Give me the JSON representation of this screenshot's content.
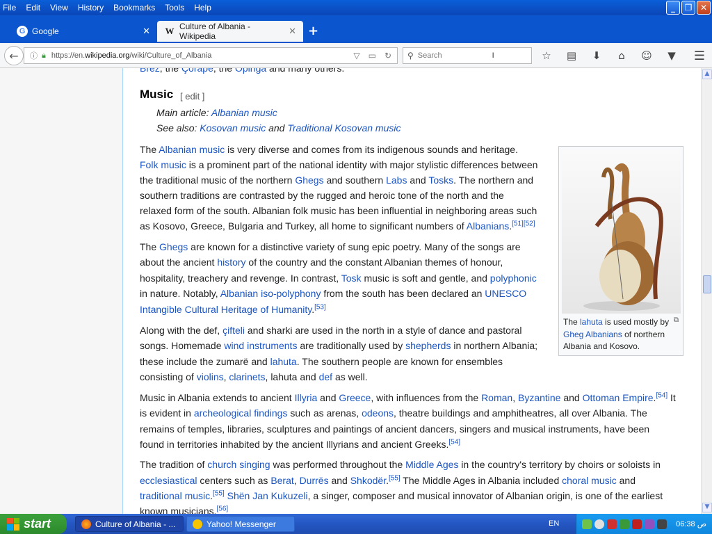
{
  "menu": [
    "File",
    "Edit",
    "View",
    "History",
    "Bookmarks",
    "Tools",
    "Help"
  ],
  "tabs": [
    {
      "label": "Google",
      "icon": "G"
    },
    {
      "label": "Culture of Albania - Wikipedia",
      "icon": "W"
    }
  ],
  "url": {
    "prefix": "https://en.",
    "domain": "wikipedia.org",
    "path": "/wiki/Culture_of_Albania"
  },
  "search": {
    "placeholder": "Search"
  },
  "article": {
    "top_line": {
      "a": "Brez",
      "sep1": ", the ",
      "b": "Çorape",
      "sep2": ", the ",
      "c": "Opinga",
      "tail": " and many others."
    },
    "heading": "Music",
    "edit": "[ edit ]",
    "main_article": {
      "label": "Main article: ",
      "link": "Albanian music"
    },
    "see_also": {
      "label": "See also: ",
      "link1": "Kosovan music",
      "and": " and ",
      "link2": "Traditional Kosovan music"
    },
    "p1": {
      "l1": {
        "a": "The ",
        "b": "Albanian music",
        "c": " is very diverse and comes from its indigenous sounds and heritage."
      },
      "l2": {
        "a": "Folk music",
        "b": " is a prominent part of the national identity with major stylistic differences between"
      },
      "l3": {
        "a": "the traditional music of the northern ",
        "b": "Ghegs",
        "c": " and southern ",
        "d": "Labs",
        "e": " and ",
        "f": "Tosks",
        "g": ". The northern and"
      },
      "l4": "southern traditions are contrasted by the rugged and heroic tone of the north and the",
      "l5": "relaxed form of the south. Albanian folk music has been influential in neighboring areas such",
      "l6": {
        "a": "as Kosovo, Greece, Bulgaria and Turkey, all home to significant numbers of ",
        "b": "Albanians",
        "c": ".",
        "sup": "[51][52]"
      }
    },
    "p2": {
      "l1": {
        "a": "The ",
        "b": "Ghegs",
        "c": " are known for a distinctive variety of sung epic poetry. Many of the songs are"
      },
      "l2": {
        "a": "about the ancient ",
        "b": "history",
        "c": " of the country and the constant Albanian themes of honour,"
      },
      "l3": {
        "a": "hospitality, treachery and revenge. In contrast, ",
        "b": "Tosk",
        "c": " music is soft and gentle, and ",
        "d": "polyphonic"
      },
      "l4": {
        "a": "in nature. Notably, ",
        "b": "Albanian iso-polyphony",
        "c": " from the south has been declared an ",
        "d": "UNESCO"
      },
      "l5": {
        "a": "Intangible Cultural Heritage of Humanity",
        "b": ".",
        "sup": "[53]"
      }
    },
    "p3": {
      "l1": {
        "a": "Along with the def, ",
        "b": "çifteli",
        "c": " and sharki are used in the north in a style of dance and pastoral"
      },
      "l2": {
        "a": "songs. Homemade ",
        "b": "wind instruments",
        "c": " are traditionally used by ",
        "d": "shepherds",
        "e": " in northern Albania;"
      },
      "l3": {
        "a": "these include the zumarë and ",
        "b": "lahuta",
        "c": ". The southern people are known for ensembles"
      },
      "l4": {
        "a": "consisting of ",
        "b": "violins",
        "c": ", ",
        "d": "clarinets",
        "e": ", lahuta and ",
        "f": "def",
        "g": " as well."
      }
    },
    "p4": {
      "l1": {
        "a": "Music in Albania extends to ancient ",
        "b": "Illyria",
        "c": " and ",
        "d": "Greece",
        "e": ", with influences from the ",
        "f": "Roman",
        "g": ", ",
        "h": "Byzantine",
        "i": " and ",
        "j": "Ottoman Empire",
        "k": ".",
        "sup": "[54]",
        "l": " It"
      },
      "l2": {
        "a": "is evident in ",
        "b": "archeological findings",
        "c": " such as arenas, ",
        "d": "odeons",
        "e": ", theatre buildings and amphitheatres, all over Albania. The"
      },
      "l3": "remains of temples, libraries, sculptures and paintings of ancient dancers, singers and musical instruments, have been",
      "l4": {
        "a": "found in territories inhabited by the ancient Illyrians and ancient Greeks.",
        "sup": "[54]"
      }
    },
    "p5": {
      "l1": {
        "a": "The tradition of ",
        "b": "church singing",
        "c": " was performed throughout the ",
        "d": "Middle Ages",
        "e": " in the country's territory by choirs or soloists in"
      },
      "l2": {
        "a": "ecclesiastical",
        "b": " centers such as ",
        "c": "Berat",
        "d": ", ",
        "e": "Durrës",
        "f": " and ",
        "g": "Shkodër",
        "h": ".",
        "sup": "[55]",
        "i": " The Middle Ages in Albania included ",
        "j": "choral music",
        "k": " and"
      },
      "l3": {
        "a": "traditional music",
        "b": ".",
        "sup": "[55]",
        "c": " ",
        "d": "Shën Jan Kukuzeli",
        "e": ", a singer, composer and musical innovator of Albanian origin, is one of the earliest"
      },
      "l4": {
        "a": "known musicians.",
        "sup": "[56]"
      }
    },
    "caption": {
      "a": "The ",
      "b": "lahuta",
      "c": " is used mostly by ",
      "d": "Gheg Albanians",
      "e": " of northern Albania and Kosovo."
    }
  },
  "taskbar": {
    "start": "start",
    "items": [
      "Culture of Albania - ...",
      "Yahoo! Messenger"
    ],
    "lang": "EN",
    "clock": "06:38 ﺹ"
  },
  "colors": {
    "link": "#1a55c2",
    "xp_blue": "#0b56cf",
    "start_green": "#2c8a2c"
  }
}
